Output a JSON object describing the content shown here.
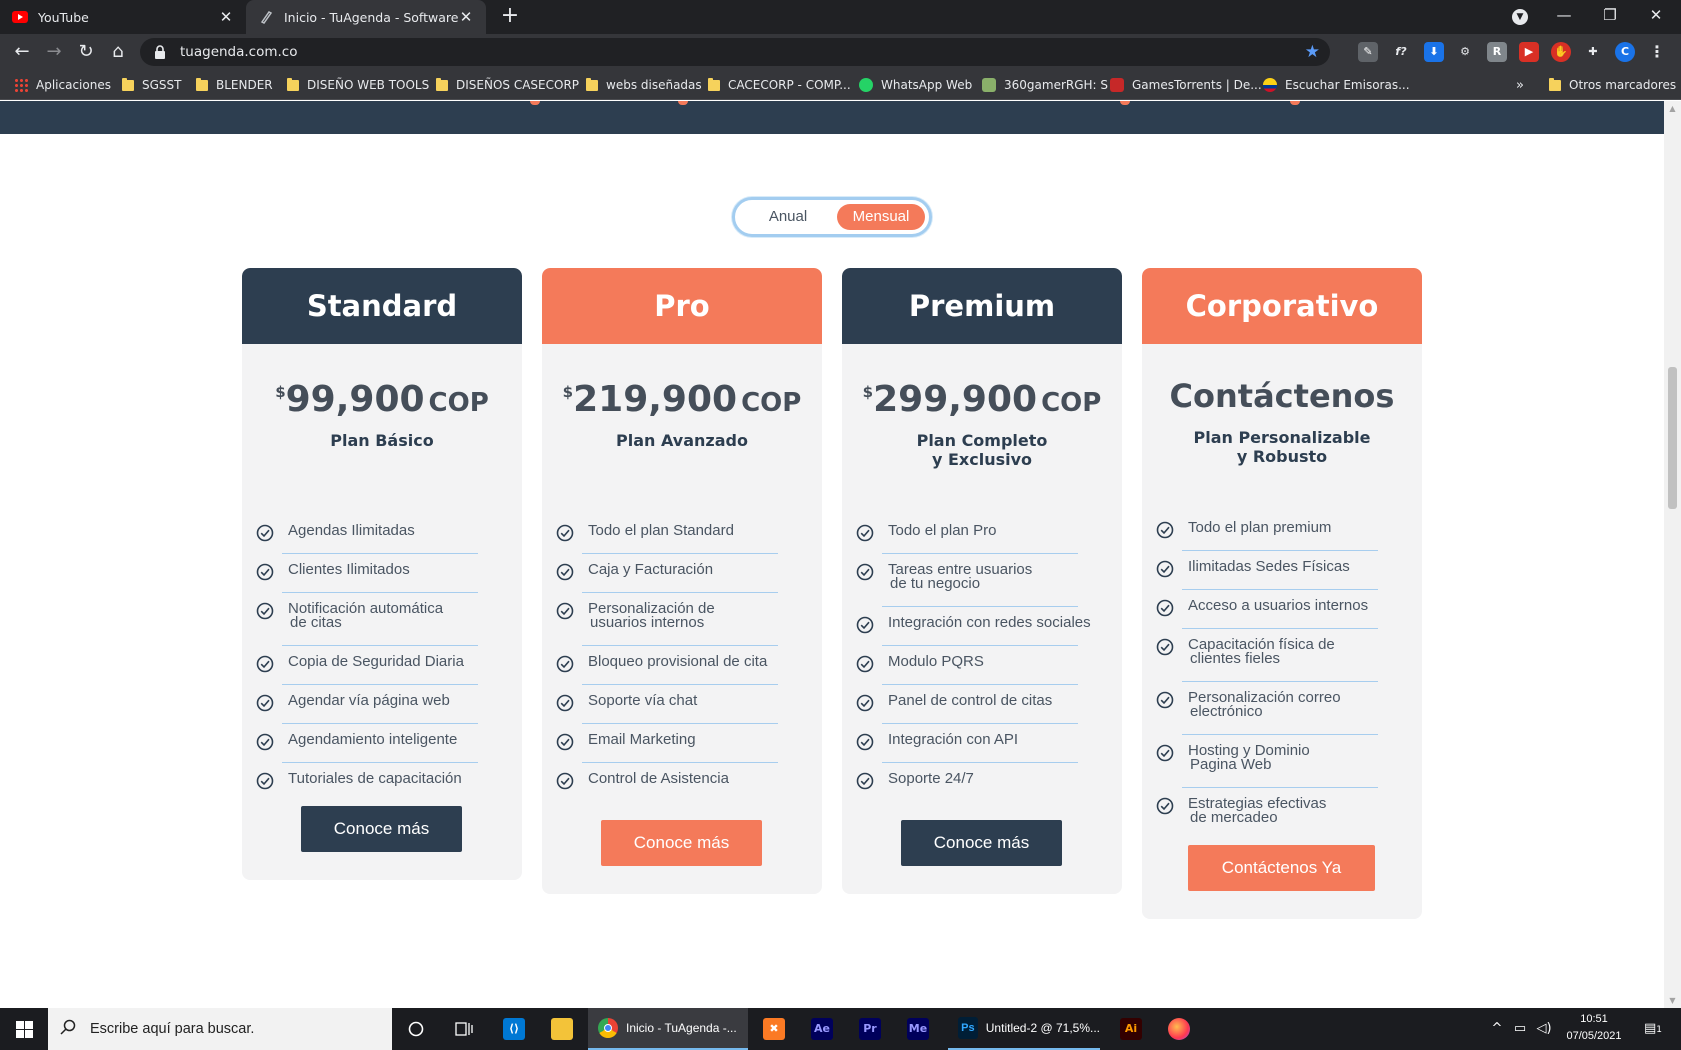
{
  "browser": {
    "tabs": [
      {
        "title": "YouTube",
        "icon": "youtube-icon",
        "active": false
      },
      {
        "title": "Inicio - TuAgenda - Software de Agendamiento",
        "icon": "tuagenda-icon",
        "active": true
      }
    ],
    "url": "tuagenda.com.co",
    "bookmarks": [
      {
        "label": "Aplicaciones",
        "icon": "apps-grid-icon"
      },
      {
        "label": "SGSST",
        "icon": "folder-icon"
      },
      {
        "label": "BLENDER",
        "icon": "folder-icon"
      },
      {
        "label": "DISEÑO WEB TOOLS",
        "icon": "folder-icon"
      },
      {
        "label": "DISEÑOS CASECORP",
        "icon": "folder-icon"
      },
      {
        "label": "webs diseñadas",
        "icon": "folder-icon"
      },
      {
        "label": "CACECORP - COMP...",
        "icon": "folder-icon"
      },
      {
        "label": "WhatsApp Web",
        "icon": "whatsapp-icon"
      },
      {
        "label": "360gamerRGH: S",
        "icon": "site-icon"
      },
      {
        "label": "GamesTorrents | De...",
        "icon": "site-icon"
      },
      {
        "label": "Escuchar Emisoras...",
        "icon": "site-icon"
      }
    ],
    "other_bookmarks": "Otros marcadores"
  },
  "pricing": {
    "toggle": {
      "annual": "Anual",
      "monthly": "Mensual",
      "selected": "Mensual"
    },
    "plans": [
      {
        "name": "Standard",
        "currency_symbol": "$",
        "price": "99,900",
        "currency_code": "COP",
        "subtitle": [
          "Plan Básico"
        ],
        "features": [
          [
            "Agendas Ilimitadas"
          ],
          [
            "Clientes Ilimitados"
          ],
          [
            "Notificación automática",
            "de citas"
          ],
          [
            "Copia de Seguridad Diaria"
          ],
          [
            "Agendar vía página web"
          ],
          [
            "Agendamiento inteligente"
          ],
          [
            "Tutoriales de capacitación"
          ]
        ],
        "button": "Conoce más"
      },
      {
        "name": "Pro",
        "currency_symbol": "$",
        "price": "219,900",
        "currency_code": "COP",
        "subtitle": [
          "Plan Avanzado"
        ],
        "features": [
          [
            "Todo el plan Standard"
          ],
          [
            "Caja y Facturación"
          ],
          [
            "Personalización de",
            "usuarios internos"
          ],
          [
            "Bloqueo provisional de cita"
          ],
          [
            "Soporte vía chat"
          ],
          [
            "Email Marketing"
          ],
          [
            "Control de Asistencia"
          ]
        ],
        "button": "Conoce más"
      },
      {
        "name": "Premium",
        "currency_symbol": "$",
        "price": "299,900",
        "currency_code": "COP",
        "subtitle": [
          "Plan Completo",
          "y Exclusivo"
        ],
        "features": [
          [
            "Todo el plan Pro"
          ],
          [
            "Tareas entre usuarios",
            "de tu negocio"
          ],
          [
            "Integración con redes sociales"
          ],
          [
            "Modulo PQRS"
          ],
          [
            "Panel de control de citas"
          ],
          [
            "Integración con API"
          ],
          [
            "Soporte 24/7"
          ]
        ],
        "button": "Conoce más"
      },
      {
        "name": "Corporativo",
        "price_text": "Contáctenos",
        "subtitle": [
          "Plan Personalizable",
          "y Robusto"
        ],
        "features": [
          [
            "Todo el plan premium"
          ],
          [
            "Ilimitadas Sedes Físicas"
          ],
          [
            "Acceso a usuarios internos"
          ],
          [
            "Capacitación física de",
            "clientes fieles"
          ],
          [
            "Personalización correo",
            "electrónico"
          ],
          [
            "Hosting y Dominio",
            "Pagina Web"
          ],
          [
            "Estrategias efectivas",
            "de mercadeo"
          ]
        ],
        "button": "Contáctenos Ya"
      }
    ]
  },
  "taskbar": {
    "search_placeholder": "Escribe aquí para buscar.",
    "apps": [
      {
        "label": "Inicio - TuAgenda -...",
        "icon": "chrome-icon"
      },
      {
        "label": "Untitled-2 @ 71,5%...",
        "icon": "photoshop-icon"
      }
    ],
    "pinned": [
      "Ae",
      "Pr",
      "Me",
      "Ai"
    ],
    "time": "10:51",
    "date": "07/05/2021",
    "notifications": "1"
  },
  "colors": {
    "navy": "#2d3e50",
    "coral": "#f47a5a",
    "card_bg": "#f3f3f4",
    "divider": "#a7cdee"
  }
}
